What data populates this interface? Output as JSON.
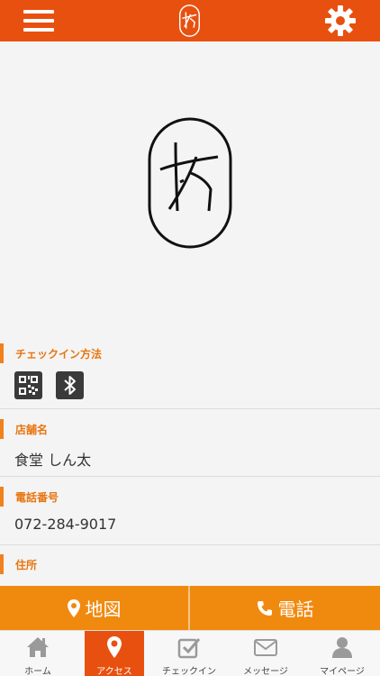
{
  "header": {
    "menu_icon": "hamburger-icon",
    "settings_icon": "gear-icon",
    "brand_color": "#e8500f"
  },
  "sections": {
    "checkin_method": {
      "label": "チェックイン方法",
      "icons": [
        "qr-code-icon",
        "bluetooth-icon"
      ]
    },
    "shop_name": {
      "label": "店舗名",
      "value": "食堂 しん太"
    },
    "phone": {
      "label": "電話番号",
      "value": "072-284-9017"
    },
    "address": {
      "label": "住所"
    }
  },
  "actions": {
    "map_label": "地図",
    "tel_label": "電話",
    "color": "#f08a0f"
  },
  "tabs": [
    {
      "label": "ホーム",
      "icon": "home-icon",
      "active": false
    },
    {
      "label": "アクセス",
      "icon": "map-pin-icon",
      "active": true
    },
    {
      "label": "チェックイン",
      "icon": "checkbox-icon",
      "active": false
    },
    {
      "label": "メッセージ",
      "icon": "envelope-icon",
      "active": false
    },
    {
      "label": "マイページ",
      "icon": "person-icon",
      "active": false
    }
  ]
}
